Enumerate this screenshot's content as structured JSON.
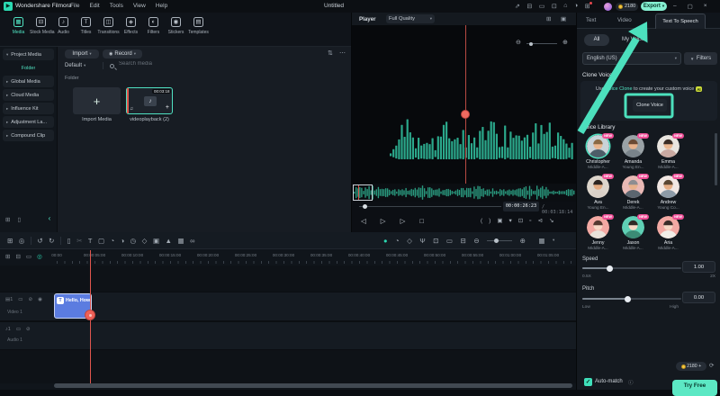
{
  "colors": {
    "accent_teal": "#50e3c2",
    "export_mint": "#85efd1",
    "annotation": "#4ce0bd",
    "playhead_red": "#ee6158",
    "clip_blue": "#5b7ce0",
    "waveform_teal": "#2ba88b",
    "new_badge_pink": "#ef4d96",
    "coin_yellow": "#f5c842"
  },
  "icons": {
    "logo": "▶",
    "caret_down": "▾",
    "caret_right": "▸",
    "minimize": "–",
    "restore": "▢",
    "close": "×",
    "record_dot": "◉",
    "sort": "⇅",
    "more": "⋯",
    "music": "♪",
    "music2": "♫",
    "plus": "+",
    "split_view": "⊞",
    "detach": "▣",
    "zoom_out": "⊖",
    "zoom_in": "⊕",
    "check": "✓",
    "info": "ⓘ",
    "refresh": "⟳",
    "funnel": "▼",
    "collapse": "‹",
    "new_folder": "⊞",
    "trash": "▯",
    "track_manage": "▦"
  },
  "menubar": {
    "app_name": "Wondershare Filmora",
    "menus": [
      "File",
      "Edit",
      "Tools",
      "View",
      "Help"
    ],
    "project_title": "Untitled",
    "coins": "2180",
    "export_label": "Export",
    "topbar_icons": [
      {
        "name": "share-icon",
        "glyph": "⇗"
      },
      {
        "name": "layout-icon",
        "glyph": "⊟"
      },
      {
        "name": "device-icon",
        "glyph": "▭"
      },
      {
        "name": "copy-icon",
        "glyph": "⊡"
      },
      {
        "name": "home-icon",
        "glyph": "⌂"
      },
      {
        "name": "theme-icon",
        "glyph": "◑"
      },
      {
        "name": "apps-icon",
        "glyph": "⊞",
        "dot": true
      }
    ]
  },
  "ribbon": {
    "tabs": [
      {
        "label": "Media",
        "icon": "▦",
        "active": true
      },
      {
        "label": "Stock Media",
        "icon": "⊟"
      },
      {
        "label": "Audio",
        "icon": "♪"
      },
      {
        "label": "Titles",
        "icon": "T"
      },
      {
        "label": "Transitions",
        "icon": "◫"
      },
      {
        "label": "Effects",
        "icon": "◈"
      },
      {
        "label": "Filters",
        "icon": "◐"
      },
      {
        "label": "Stickers",
        "icon": "◉"
      },
      {
        "label": "Templates",
        "icon": "▤"
      }
    ]
  },
  "sidebar": {
    "items": [
      {
        "label": "Project Media",
        "chevron": "▾"
      },
      {
        "label": "Folder",
        "selected": true,
        "child": true
      },
      {
        "label": "Global Media",
        "chevron": "▸"
      },
      {
        "label": "Cloud Media",
        "chevron": "▸"
      },
      {
        "label": "Influence Kit",
        "chevron": "▸"
      },
      {
        "label": "Adjustment La...",
        "chevron": "▸"
      },
      {
        "label": "Compound Clip",
        "chevron": "▸"
      }
    ]
  },
  "media": {
    "import_label": "Import",
    "record_label": "Record",
    "preset_label": "Default",
    "search_placeholder": "Search media",
    "group_label": "Folder",
    "sort_icon": "⇅",
    "more_icon": "⋯",
    "cards": [
      {
        "label": "Import Media"
      },
      {
        "label": "videoplayback (2)",
        "duration": "00:03:18"
      }
    ]
  },
  "player": {
    "title": "Player",
    "quality": "Full Quality",
    "current_time": "00:00:26:23",
    "separator": "/",
    "total_time": "00:03:18:14",
    "transport_left": [
      {
        "name": "prev-frame-icon",
        "glyph": "◁"
      },
      {
        "name": "play-icon",
        "glyph": "▷"
      },
      {
        "name": "next-frame-icon",
        "glyph": "▷"
      },
      {
        "name": "stop-icon",
        "glyph": "□"
      }
    ],
    "transport_right": [
      {
        "name": "mark-in-icon",
        "glyph": "("
      },
      {
        "name": "mark-out-icon",
        "glyph": ")"
      },
      {
        "name": "snapshot-icon",
        "glyph": "▣"
      },
      {
        "name": "snapshot-dropdown-icon",
        "glyph": "▾"
      },
      {
        "name": "display-mode-icon",
        "glyph": "⊡"
      },
      {
        "name": "pip-icon",
        "glyph": "▫"
      },
      {
        "name": "mute-icon",
        "glyph": "⊲"
      },
      {
        "name": "fullscreen-icon",
        "glyph": "↘"
      }
    ]
  },
  "timeline": {
    "toolbar_left": [
      {
        "name": "import-media-icon",
        "glyph": "⊞"
      },
      {
        "name": "select-tool-icon",
        "glyph": "◎"
      },
      {
        "divider": true
      },
      {
        "name": "undo-icon",
        "glyph": "↺"
      },
      {
        "name": "redo-icon",
        "glyph": "↻"
      },
      {
        "divider": true
      },
      {
        "name": "delete-icon",
        "glyph": "▯"
      },
      {
        "name": "split-icon",
        "glyph": "✂",
        "dim": true
      },
      {
        "name": "text-tool-icon",
        "glyph": "T"
      },
      {
        "name": "crop-icon",
        "glyph": "▢"
      },
      {
        "name": "speed-tool-icon",
        "glyph": "◔"
      },
      {
        "name": "color-tool-icon",
        "glyph": "◑"
      },
      {
        "name": "duration-icon",
        "glyph": "◷"
      },
      {
        "name": "keyframe-icon",
        "glyph": "◇"
      },
      {
        "name": "copy-attributes-icon",
        "glyph": "▣"
      },
      {
        "name": "chroma-key-icon",
        "glyph": "▲"
      },
      {
        "name": "render-preview-icon",
        "glyph": "▦"
      },
      {
        "name": "link-icon",
        "glyph": "∞"
      }
    ],
    "toolbar_right": [
      {
        "name": "voiceover-record-icon",
        "glyph": "●",
        "teal": true
      },
      {
        "name": "speed-ramp-icon",
        "glyph": "◔"
      },
      {
        "name": "marker-icon",
        "glyph": "◇"
      },
      {
        "name": "mic-icon",
        "glyph": "Ψ"
      },
      {
        "name": "screen-record-icon",
        "glyph": "⊡"
      },
      {
        "name": "device-icon",
        "glyph": "▭"
      },
      {
        "name": "mixer-icon",
        "glyph": "⊟"
      }
    ],
    "ruler_header_icons": [
      {
        "name": "add-track-icon",
        "glyph": "⊞"
      },
      {
        "name": "mixer-icon",
        "glyph": "⊟"
      },
      {
        "name": "marker-icon",
        "glyph": "▭"
      },
      {
        "name": "snap-icon",
        "glyph": "◎",
        "teal": true
      }
    ],
    "ruler_labels": [
      "00:00",
      "00:00:05:00",
      "00:00:10:00",
      "00:00:15:00",
      "00:00:20:00",
      "00:00:25:00",
      "00:00:30:00",
      "00:00:35:00",
      "00:00:40:00",
      "00:00:45:00",
      "00:00:50:00",
      "00:00:55:00",
      "00:01:00:00",
      "00:01:05:00"
    ],
    "video_track_icons": [
      {
        "name": "video-track-icon",
        "glyph": "▤1"
      },
      {
        "name": "folder-icon",
        "glyph": "▭"
      },
      {
        "name": "lock-icon",
        "glyph": "⊘"
      },
      {
        "name": "eye-icon",
        "glyph": "◉"
      }
    ],
    "audio_track_icons": [
      {
        "name": "audio-track-icon",
        "glyph": "♪1"
      },
      {
        "name": "folder-icon",
        "glyph": "▭"
      },
      {
        "name": "lock-icon",
        "glyph": "⊘"
      }
    ],
    "video_label": "Video 1",
    "audio_label": "Audio 1",
    "clip_label": "Hello, How...",
    "clip_icon": "T"
  },
  "tts": {
    "tabs": [
      "Text",
      "Video",
      "Text To Speech"
    ],
    "active_tab": "Text To Speech",
    "chip_all": "All",
    "chip_partial": "My Voice",
    "language": "English (US)",
    "filters_label": "Filters",
    "clone_title": "Clone Voice",
    "clone_text_prefix": "Use ",
    "clone_link": "Voice Clone",
    "clone_text_suffix": " to create your custom voice ",
    "ai_badge": "AI",
    "clone_button": "Clone Voice",
    "library_title": "Voice Library",
    "new_label": "NEW",
    "voices": [
      {
        "name": "Christopher",
        "desc": "Middle-A...",
        "ring": true,
        "bg": "#c9d3d8",
        "skin": "#e9b68e",
        "hair": "#8a6a44",
        "shirt": "#4d5d68"
      },
      {
        "name": "Amanda",
        "desc": "Young En...",
        "bg": "#9aa2a6",
        "skin": "#e7b28c",
        "hair": "#6b4a34",
        "shirt": "#79838a"
      },
      {
        "name": "Emma",
        "desc": "Middle-A...",
        "bg": "#e9e5df",
        "skin": "#eab790",
        "hair": "#3a2d25",
        "shirt": "#c9a9a1"
      },
      {
        "name": "Ava",
        "desc": "Young En...",
        "bg": "#ddd5cb",
        "skin": "#e3a97f",
        "hair": "#2c241f",
        "shirt": "#d9d0c7"
      },
      {
        "name": "Derek",
        "desc": "Middle-A...",
        "bg": "#e9b9b5",
        "skin": "#e7b18b",
        "hair": "#8d8d91",
        "shirt": "#5b656f"
      },
      {
        "name": "Andrew",
        "desc": "Young Co...",
        "bg": "#f1e7e3",
        "skin": "#e5ad85",
        "hair": "#5b4733",
        "shirt": "#8d9ba7"
      },
      {
        "name": "Jenny",
        "desc": "Middle-A...",
        "bg": "#f3a9a3",
        "skin": "#f7d8c5",
        "hair": "#553930",
        "shirt": "#eae2da"
      },
      {
        "name": "Jason",
        "desc": "Middle-A...",
        "bg": "#5fd0b5",
        "skin": "#f7d8c5",
        "hair": "#2f2925",
        "shirt": "#3b8b75"
      },
      {
        "name": "Aria",
        "desc": "Middle-A...",
        "bg": "#f3a9a3",
        "skin": "#f7d8c5",
        "hair": "#3b2d29",
        "shirt": "#f1ede7"
      }
    ],
    "speed": {
      "label": "Speed",
      "value": "1.00",
      "min": "0.5X",
      "max": "2X"
    },
    "pitch": {
      "label": "Pitch",
      "value": "0.00",
      "min": "Low",
      "max": "High"
    },
    "auto_match": "Auto-match",
    "coins": "2180",
    "try_label": "Try Free"
  }
}
